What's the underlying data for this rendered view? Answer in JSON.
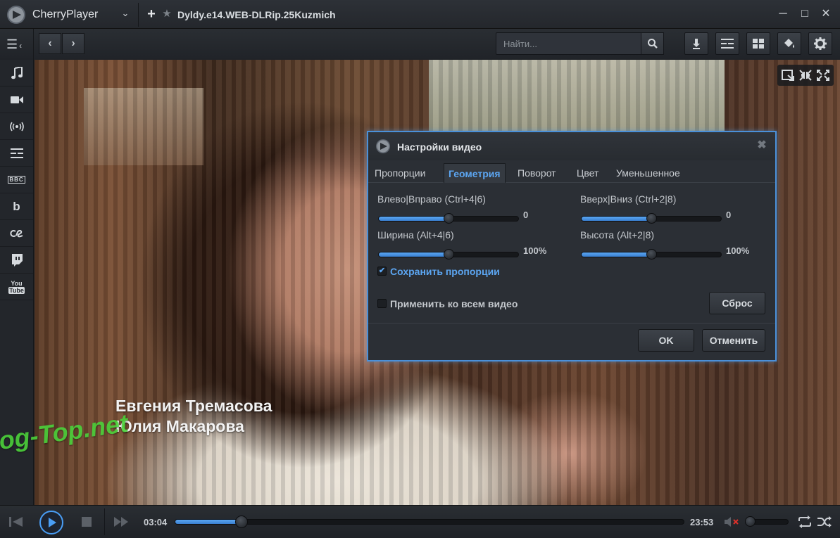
{
  "app": {
    "name": "CherryPlayer",
    "media_title": "Dyldy.e14.WEB-DLRip.25Kuzmich"
  },
  "search": {
    "placeholder": "Найти..."
  },
  "video": {
    "captions": [
      "Евгения Тремасова",
      "Юлия Макарова"
    ],
    "watermark": "Prog-Top.net"
  },
  "sidebar": {
    "items": [
      {
        "icon": "music-icon"
      },
      {
        "icon": "camera-icon"
      },
      {
        "icon": "radio-icon"
      },
      {
        "icon": "tv-guide-icon"
      },
      {
        "icon": "bbc-icon",
        "text": "BBC"
      },
      {
        "icon": "b-icon",
        "text": "b"
      },
      {
        "icon": "lastfm-icon"
      },
      {
        "icon": "twitch-icon"
      },
      {
        "icon": "youtube-icon",
        "text_top": "You",
        "text_bottom": "Tube"
      }
    ]
  },
  "dialog": {
    "title": "Настройки видео",
    "tabs": [
      "Пропорции",
      "Геометрия",
      "Поворот",
      "Цвет",
      "Уменьшенное"
    ],
    "active_tab": "Геометрия",
    "controls": {
      "left_right": {
        "label": "Влево|Вправо (Ctrl+4|6)",
        "value_text": "0",
        "level": 0.5
      },
      "up_down": {
        "label": "Вверх|Вниз (Ctrl+2|8)",
        "value_text": "0",
        "level": 0.5
      },
      "width": {
        "label": "Ширина (Alt+4|6)",
        "value_text": "100%",
        "level": 0.5
      },
      "height": {
        "label": "Высота (Alt+2|8)",
        "value_text": "100%",
        "level": 0.5
      }
    },
    "keep_aspect": {
      "label": "Сохранить пропорции",
      "checked": true
    },
    "apply_all": {
      "label": "Применить ко всем видео",
      "checked": false
    },
    "reset_label": "Сброс",
    "ok_label": "OK",
    "cancel_label": "Отменить"
  },
  "playback": {
    "current_time": "03:04",
    "total_time": "23:53",
    "progress": 0.13,
    "volume": 0.1
  },
  "colors": {
    "accent": "#4a9ef5",
    "dialog_border": "#4a90d9",
    "mute_x": "#e0302a",
    "watermark": "#4bd13a"
  }
}
